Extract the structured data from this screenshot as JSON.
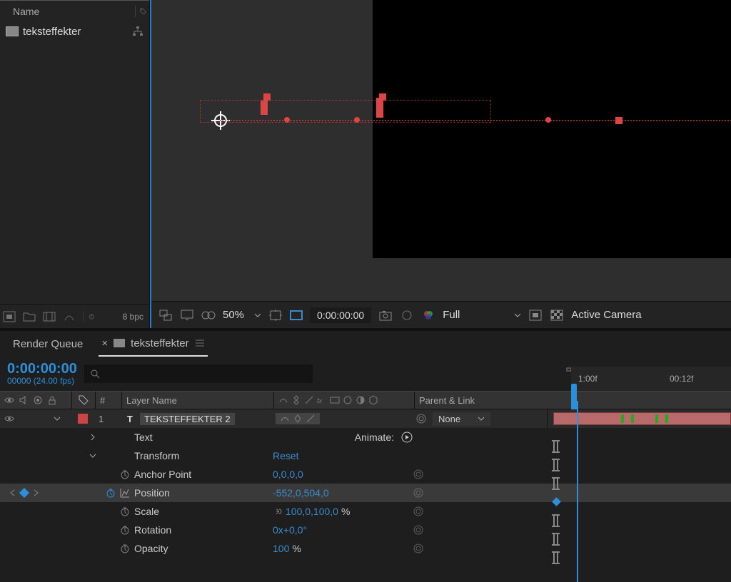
{
  "project": {
    "name_header": "Name",
    "item_name": "teksteffekter",
    "bpc": "8 bpc"
  },
  "viewer": {
    "zoom": "50%",
    "timecode": "0:00:00:00",
    "resolution": "Full",
    "active_view": "Active Camera"
  },
  "timeline": {
    "render_queue_tab": "Render Queue",
    "active_tab": "teksteffekter",
    "current_time": "0:00:00:00",
    "frame_info": "00000 (24.00 fps)",
    "ruler_times": [
      "1:00f",
      "00:12f"
    ],
    "columns": {
      "idx": "#",
      "layer_name": "Layer Name",
      "parent": "Parent & Link"
    },
    "layer": {
      "index": "1",
      "type_icon": "T",
      "name": "TEKSTEFFEKTER 2",
      "parent": "None"
    },
    "groups": {
      "text": "Text",
      "animate_label": "Animate:",
      "transform": "Transform",
      "reset": "Reset"
    },
    "props": {
      "anchor": {
        "label": "Anchor Point",
        "value": "0,0,0,0"
      },
      "position": {
        "label": "Position",
        "value": "-552,0,504,0"
      },
      "scale": {
        "label": "Scale",
        "value": "100,0,100,0",
        "suffix": "%"
      },
      "rotation": {
        "label": "Rotation",
        "value": "0x+0,0°"
      },
      "opacity": {
        "label": "Opacity",
        "value": "100",
        "suffix": "%"
      }
    }
  }
}
